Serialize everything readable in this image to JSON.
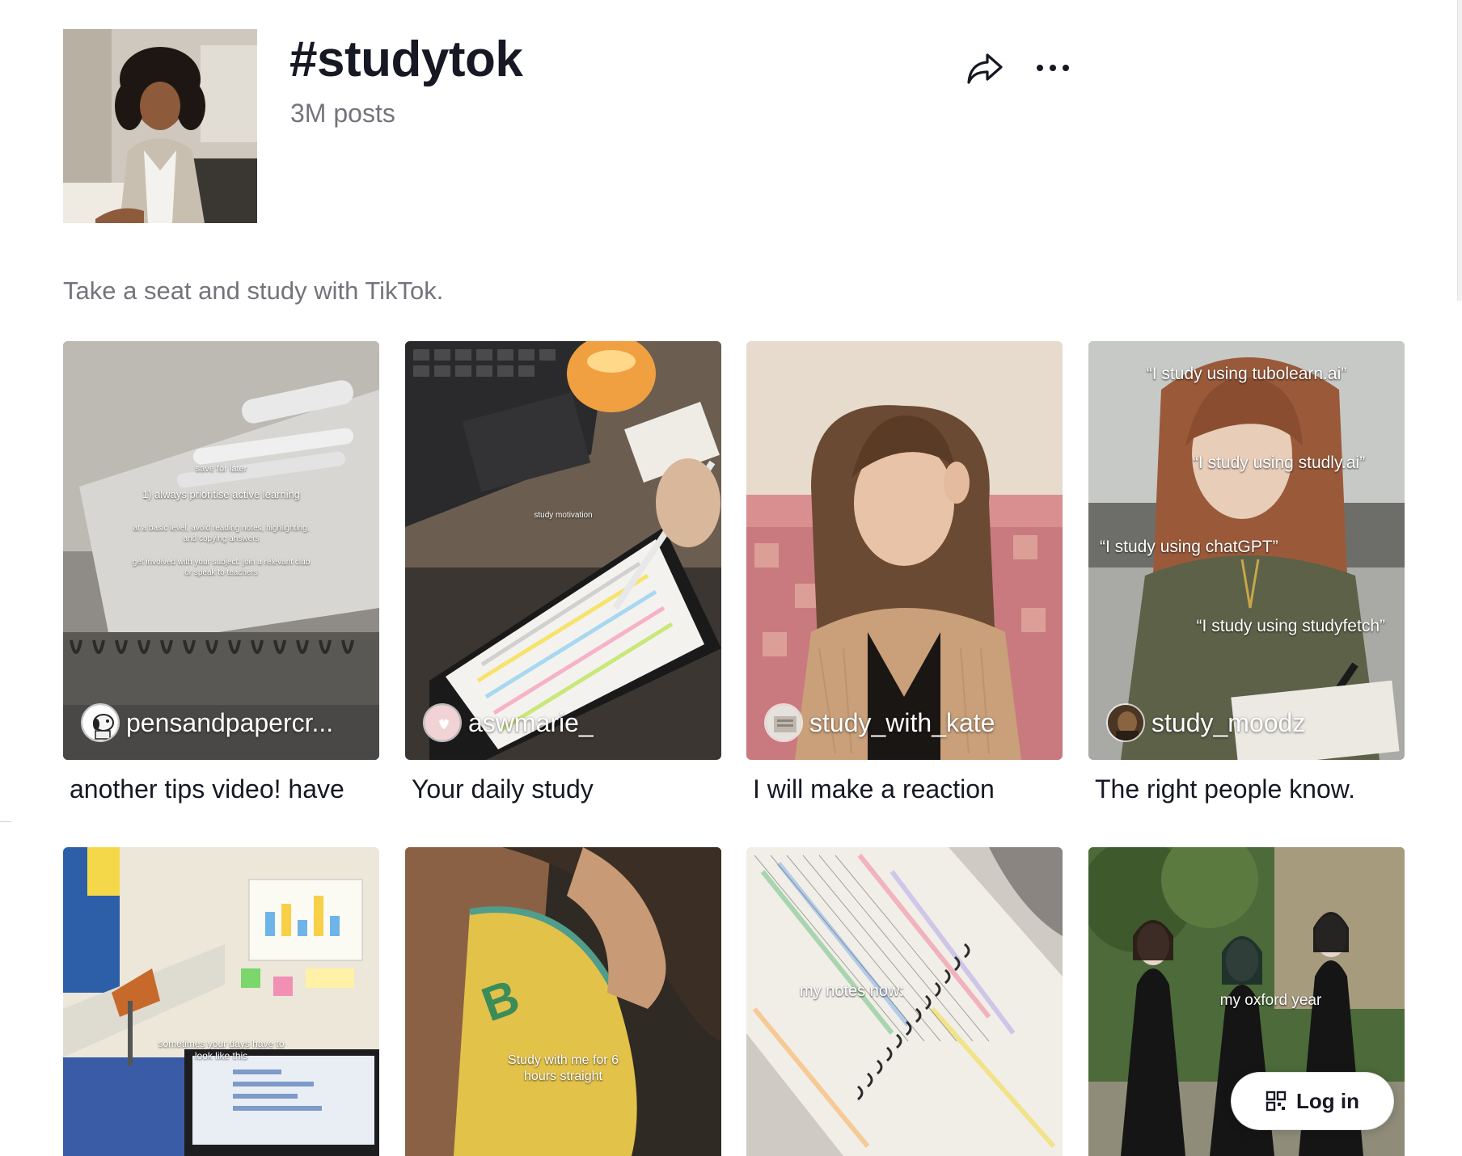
{
  "hashtag": {
    "title": "#studytok",
    "posts_count": "3M posts",
    "description": "Take a seat and study with TikTok."
  },
  "actions": {
    "share_icon": "share-arrow-icon",
    "more_icon": "more-dots-icon"
  },
  "videos": [
    {
      "author": "pensandpapercr...",
      "caption": "another tips video! have",
      "overlay": [
        "save for later",
        "1) always prioritise active learning",
        "at a basic level, avoid reading notes, highlighting, and copying answers",
        "get involved with your subject: join a relevant club or speak to teachers"
      ]
    },
    {
      "author": "aswmarie_",
      "caption": "Your daily study",
      "overlay": [
        "study motivation"
      ]
    },
    {
      "author": "study_with_kate",
      "caption": "I will make a reaction",
      "overlay": []
    },
    {
      "author": "study_moodz",
      "caption": "The right people know.",
      "overlay": [
        "“I study using tubolearn.ai”",
        "“I study using studly.ai”",
        "“I study using chatGPT”",
        "“I study using studyfetch”"
      ]
    },
    {
      "author": "",
      "caption": "",
      "overlay": [
        "sometimes your days have to look like this"
      ]
    },
    {
      "author": "",
      "caption": "",
      "overlay": [
        "Study with me for 6 hours straight"
      ]
    },
    {
      "author": "",
      "caption": "",
      "overlay": [
        "my notes now:"
      ]
    },
    {
      "author": "",
      "caption": "",
      "overlay": [
        "my oxford year"
      ]
    }
  ],
  "login": {
    "label": "Log in",
    "icon": "qr-code-icon"
  },
  "colors": {
    "text_primary": "#161823",
    "text_secondary": "rgba(22,24,35,0.6)",
    "background": "#ffffff"
  }
}
